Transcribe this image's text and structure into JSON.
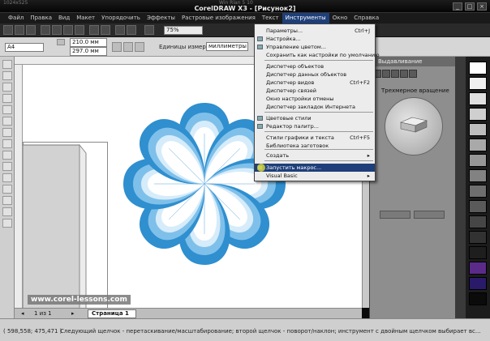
{
  "window": {
    "caption_left": "1024x525",
    "caption_center": "Win Rlan 5 10",
    "title": "CorelDRAW X3 - [Рисунок2]"
  },
  "menubar": {
    "items": [
      "Файл",
      "Правка",
      "Вид",
      "Макет",
      "Упорядочить",
      "Эффекты",
      "Растровые изображения",
      "Текст",
      "Инструменты",
      "Окно",
      "Справка"
    ],
    "active_index": 8
  },
  "propertybar": {
    "paper": "A4",
    "width": "210.0 мм",
    "height": "297.0 мм",
    "zoom": "75%",
    "units_label": "Единицы измерения:",
    "units_value": "миллиметры"
  },
  "tools_menu": {
    "items": [
      {
        "label": "Параметры...",
        "shortcut": "Ctrl+J"
      },
      {
        "label": "Настройка...",
        "shortcut": ""
      },
      {
        "label": "Управление цветом...",
        "shortcut": ""
      },
      {
        "label": "Сохранить как настройки по умолчанию",
        "shortcut": ""
      },
      {
        "label": "Диспетчер объектов",
        "shortcut": ""
      },
      {
        "label": "Диспетчер данных объектов",
        "shortcut": ""
      },
      {
        "label": "Диспетчер видов",
        "shortcut": "Ctrl+F2"
      },
      {
        "label": "Диспетчер связей",
        "shortcut": ""
      },
      {
        "label": "Окно настройки отмены",
        "shortcut": ""
      },
      {
        "label": "Диспетчер закладок Интернета",
        "shortcut": ""
      },
      {
        "label": "Цветовые стили",
        "shortcut": ""
      },
      {
        "label": "Редактор палитр...",
        "shortcut": ""
      },
      {
        "label": "Стили графики и текста",
        "shortcut": "Ctrl+F5"
      },
      {
        "label": "Библиотека заготовок",
        "shortcut": ""
      },
      {
        "label": "Создать",
        "shortcut": "▸"
      },
      {
        "label": "Запустить макрос...",
        "shortcut": ""
      },
      {
        "label": "Visual Basic",
        "shortcut": "▸"
      }
    ],
    "selected_index": 15
  },
  "docker": {
    "title": "Выдавливание",
    "subtitle": "Трехмерное вращение"
  },
  "pagebar": {
    "page_counter": "1 из 1",
    "page_tab": "Страница 1"
  },
  "watermark": "www.corel-lessons.com",
  "status": {
    "coords": "( 598,558; 475,471 )",
    "hint": "Следующий щелчок - перетаскивание/масштабирование; второй щелчок - поворот/наклон; инструмент с двойным щелчком выбирает вс..."
  },
  "colors": {
    "accent": "#1e3f7a",
    "flower_outer": "#2f8fcf",
    "flower_inner": "#ffffff"
  }
}
